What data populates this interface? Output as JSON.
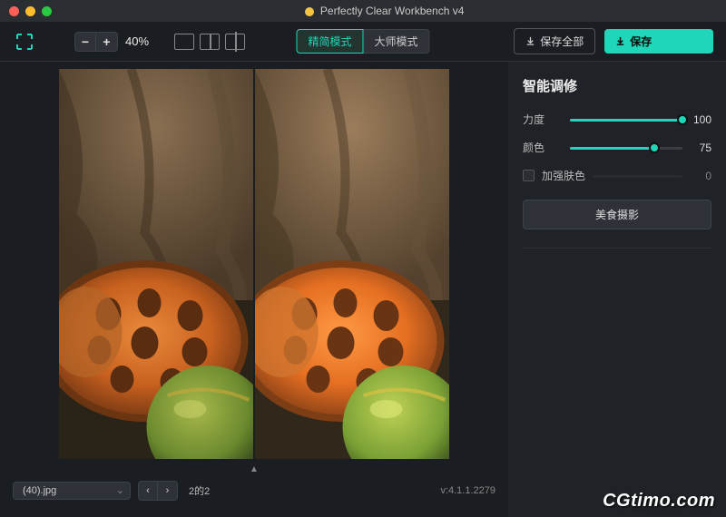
{
  "window": {
    "title": "Perfectly Clear Workbench v4"
  },
  "toolbar": {
    "zoom_level": "40%",
    "mode_simple": "精简模式",
    "mode_master": "大师模式",
    "save_all": "保存全部",
    "save": "保存"
  },
  "panel": {
    "title": "智能调修",
    "strength": {
      "label": "力度",
      "value": 100
    },
    "color": {
      "label": "颜色",
      "value": 75
    },
    "skin": {
      "label": "加强肤色",
      "value": 0,
      "checked": false
    },
    "preset_button": "美食摄影"
  },
  "bottom": {
    "filename": "(40).jpg",
    "page_info": "2的2",
    "version": "v:4.1.1.2279"
  },
  "watermark": "CGtimo.com",
  "colors": {
    "accent": "#1fd6b8"
  }
}
